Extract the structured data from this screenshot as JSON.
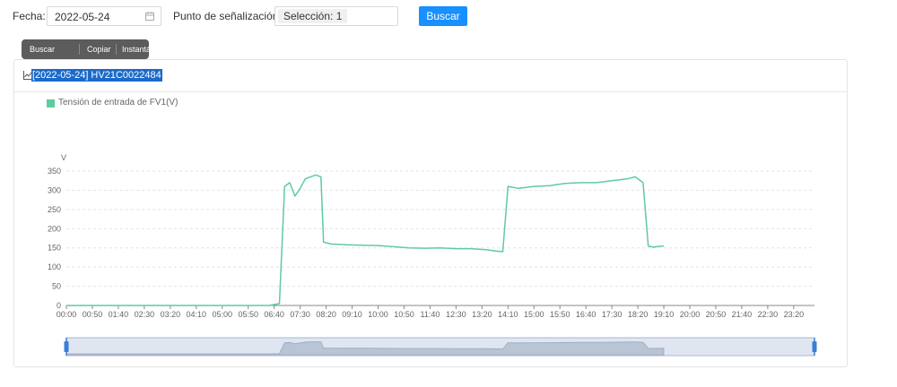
{
  "toolbar": {
    "date_label": "Fecha:",
    "date_value": "2022-05-24",
    "point_label": "Punto de señalización:",
    "point_tag": "Selección: 1",
    "search_label": "Buscar"
  },
  "popover": {
    "items": [
      "Buscar",
      "Copiar",
      "Instantánea"
    ]
  },
  "card": {
    "title": "[2022-05-24] HV21C0022484"
  },
  "colors": {
    "accent": "#1890ff",
    "series": "#5ecba0",
    "selection": "#1b6ac9"
  },
  "chart_data": {
    "type": "line",
    "ylabel": "V",
    "ylim": [
      0,
      350
    ],
    "yticks": [
      0,
      50,
      100,
      150,
      200,
      250,
      300,
      350
    ],
    "grid": true,
    "legend_position": "top-left",
    "x_ticks": [
      "00:00",
      "00:50",
      "01:40",
      "02:30",
      "03:20",
      "04:10",
      "05:00",
      "05:50",
      "06:40",
      "07:30",
      "08:20",
      "09:10",
      "10:00",
      "10:50",
      "11:40",
      "12:30",
      "13:20",
      "14:10",
      "15:00",
      "15:50",
      "16:40",
      "17:30",
      "18:20",
      "19:10",
      "20:00",
      "20:50",
      "21:40",
      "22:30",
      "23:20"
    ],
    "series": [
      {
        "name": "Tensión de entrada de FV1(V)",
        "x": [
          "00:00",
          "06:30",
          "06:50",
          "07:00",
          "07:10",
          "07:20",
          "07:30",
          "07:40",
          "07:50",
          "08:00",
          "08:10",
          "08:15",
          "08:30",
          "09:00",
          "09:30",
          "10:00",
          "10:30",
          "11:00",
          "11:30",
          "12:00",
          "12:30",
          "13:00",
          "13:30",
          "13:45",
          "14:00",
          "14:10",
          "14:30",
          "15:00",
          "15:30",
          "16:00",
          "16:30",
          "17:00",
          "17:30",
          "18:00",
          "18:15",
          "18:30",
          "18:40",
          "18:50",
          "19:00",
          "19:10"
        ],
        "values": [
          0,
          0,
          5,
          310,
          320,
          285,
          305,
          330,
          335,
          340,
          335,
          165,
          160,
          158,
          157,
          156,
          153,
          150,
          149,
          150,
          148,
          148,
          145,
          142,
          140,
          310,
          305,
          310,
          312,
          318,
          320,
          320,
          325,
          330,
          335,
          320,
          155,
          152,
          154,
          155
        ]
      }
    ]
  }
}
